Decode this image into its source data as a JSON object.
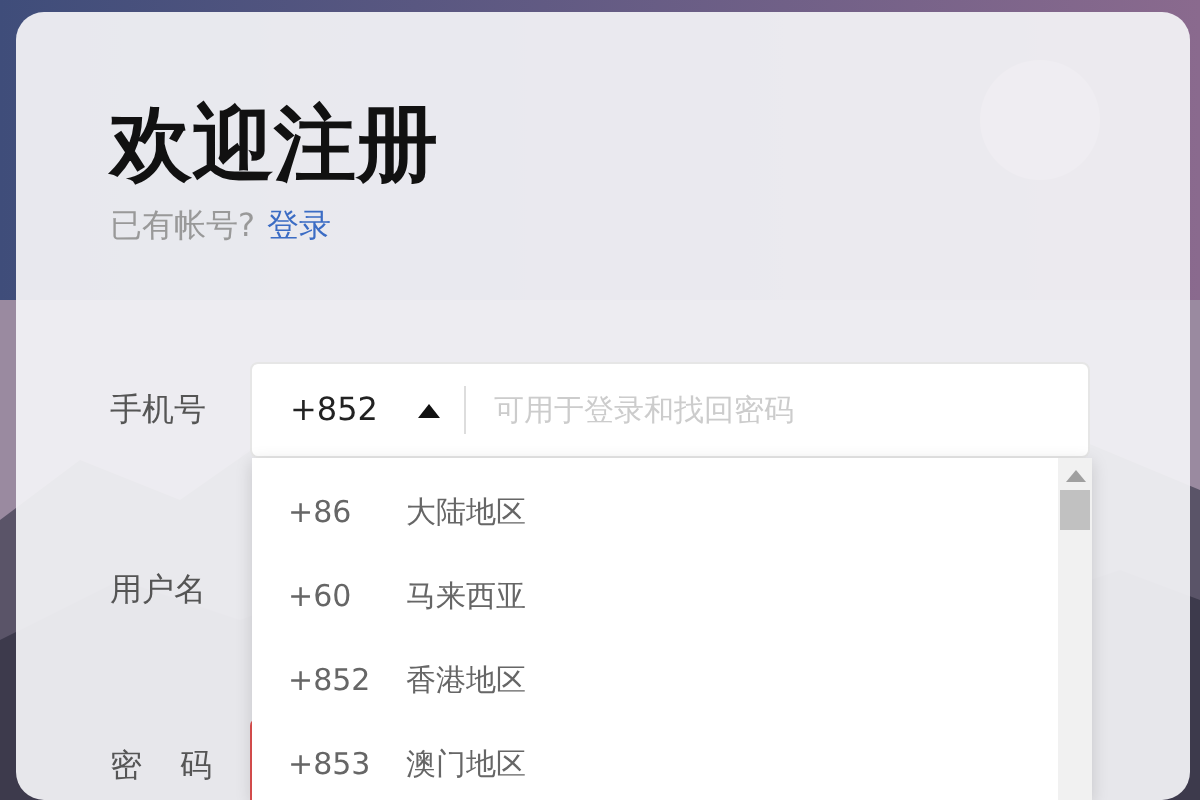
{
  "title": "欢迎注册",
  "login_prompt": {
    "text": "已有帐号?",
    "link": "登录"
  },
  "phone": {
    "label": "手机号",
    "country_code": "+852",
    "dropdown_expanded": true,
    "placeholder": "可用于登录和找回密码"
  },
  "username": {
    "label": "用户名"
  },
  "password": {
    "label": "密 码",
    "invalid": true
  },
  "country_options": [
    {
      "code": "+86",
      "region": "大陆地区"
    },
    {
      "code": "+60",
      "region": "马来西亚"
    },
    {
      "code": "+852",
      "region": "香港地区"
    },
    {
      "code": "+853",
      "region": "澳门地区"
    }
  ]
}
